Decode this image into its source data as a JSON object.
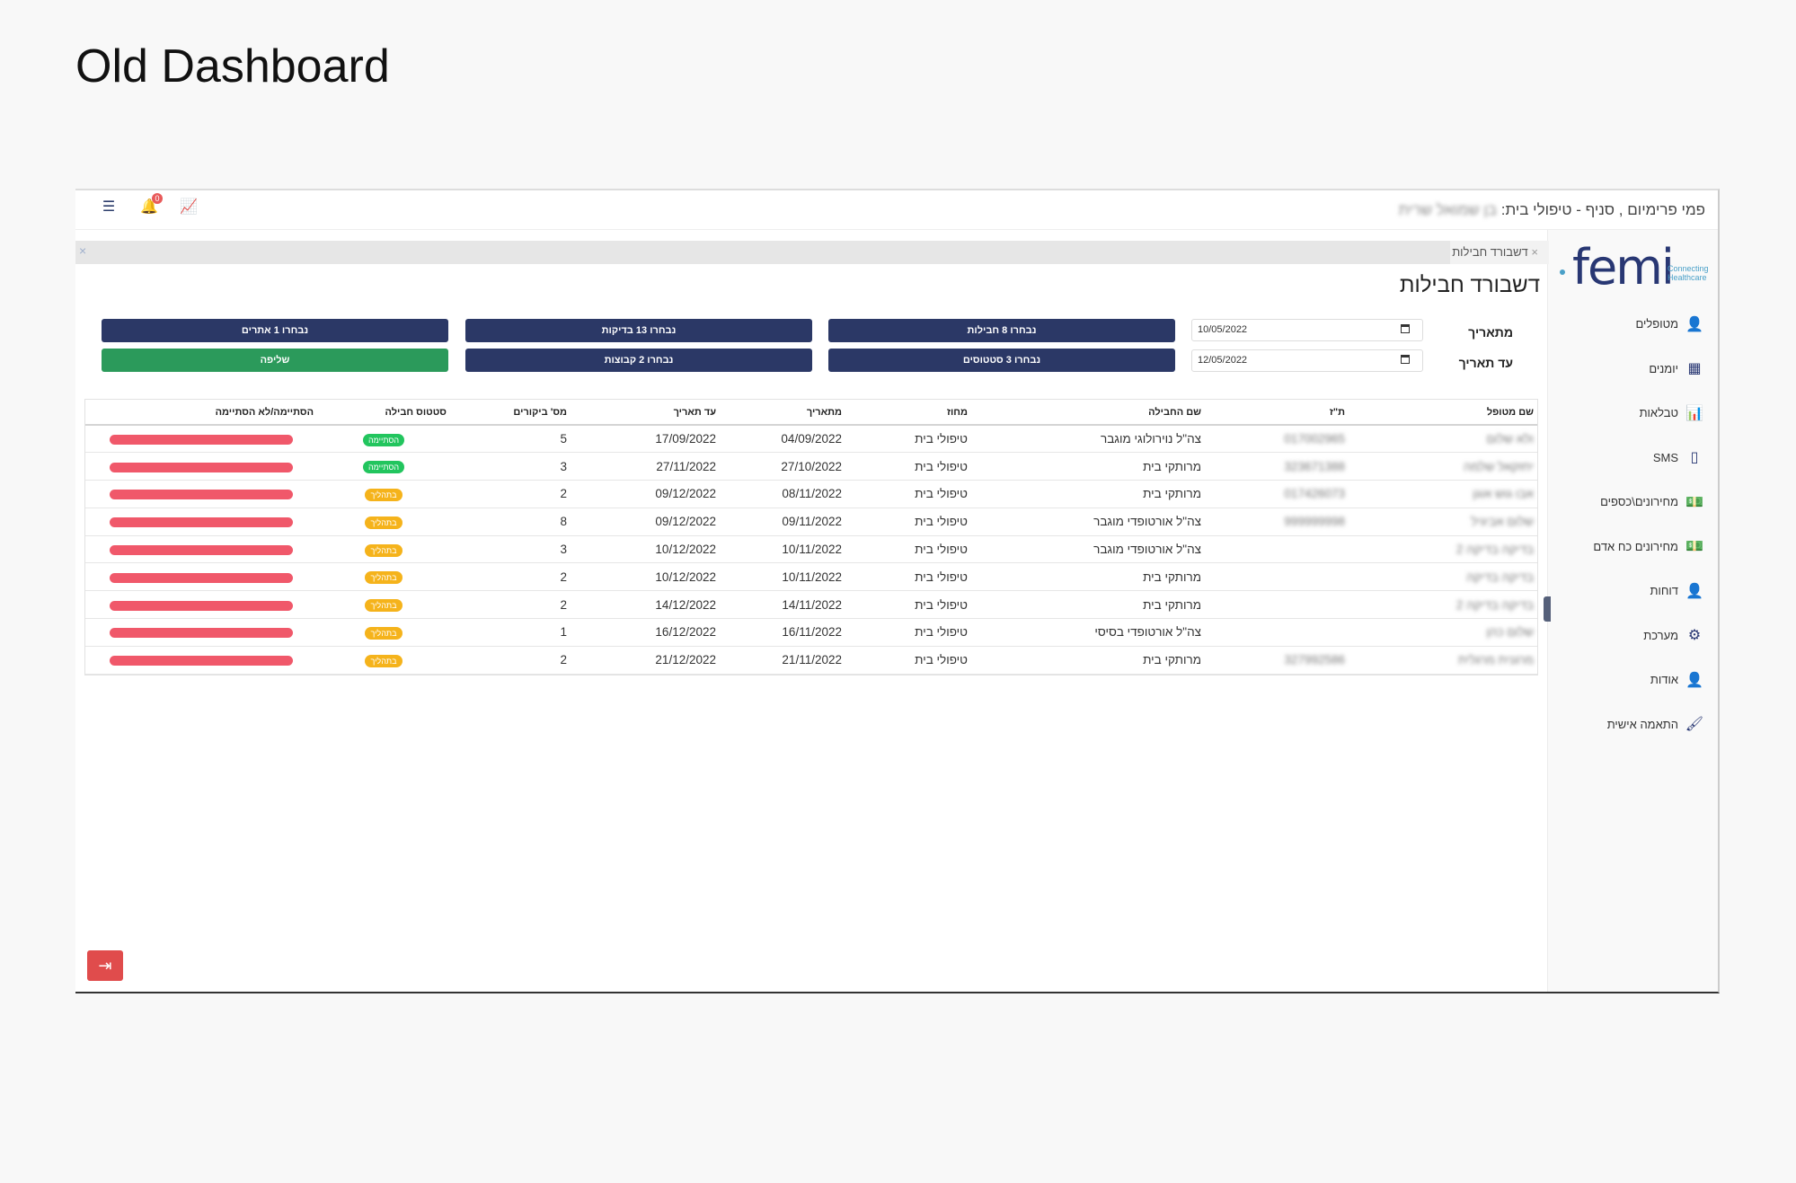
{
  "page_title": "Old Dashboard",
  "topbar": {
    "title_prefix": "פמי פרימיום , סניף - טיפולי בית:",
    "title_user": "בן שמואל שרית",
    "notification_count": "0"
  },
  "logo": {
    "text": "femi",
    "sub": "Connecting Healthcare"
  },
  "sidebar": {
    "items": [
      {
        "label": "מטופלים",
        "icon": "user-icon"
      },
      {
        "label": "יומנים",
        "icon": "calendar-icon"
      },
      {
        "label": "טבלאות",
        "icon": "chart-bar-icon"
      },
      {
        "label": "SMS",
        "icon": "mobile-icon"
      },
      {
        "label": "מחירונים\\כספים",
        "icon": "money-icon"
      },
      {
        "label": "מחירונים כח אדם",
        "icon": "money-icon"
      },
      {
        "label": "דוחות",
        "icon": "user-icon"
      },
      {
        "label": "מערכת",
        "icon": "gears-icon"
      },
      {
        "label": "אודות",
        "icon": "user-icon"
      },
      {
        "label": "התאמה אישית",
        "icon": "brush-icon"
      }
    ]
  },
  "tab": {
    "label": "דשבורד חבילות",
    "close": "×"
  },
  "tabstrip_close": "×",
  "dashboard_title": "דשבורד חבילות",
  "filters": {
    "from_label": "מתאריך",
    "to_label": "עד תאריך",
    "from_value": "10/05/2022",
    "to_value": "12/05/2022",
    "buttons": {
      "packages": "נבחרו 8 חבילות",
      "tests": "נבחרו 13 בדיקות",
      "sites": "נבחרו 1 אתרים",
      "statuses": "נבחרו 3 סטטוסים",
      "groups": "נבחרו 2 קבוצות",
      "fetch": "שליפה"
    }
  },
  "table": {
    "headers": [
      "שם מטופל",
      "ת\"ז",
      "שם החבילה",
      "מחוז",
      "מתאריך",
      "עד תאריך",
      "מס' ביקורים",
      "סטטוס חבילה",
      "הסתיימה/לא הסתיימה"
    ],
    "rows": [
      {
        "name": "ולא שלום",
        "id": "017002965",
        "package": "צה\"ל נוירולוגי מוגבר",
        "district": "טיפולי בית",
        "from": "04/09/2022",
        "to": "17/09/2022",
        "visits": "5",
        "status": "הסתיימה",
        "status_type": "done"
      },
      {
        "name": "יחזקאל שלמה",
        "id": "323671388",
        "package": "מרותקי בית",
        "district": "טיפולי בית",
        "from": "27/10/2022",
        "to": "27/11/2022",
        "visits": "3",
        "status": "הסתיימה",
        "status_type": "done"
      },
      {
        "name": "אבו גוש אוגן",
        "id": "017426073",
        "package": "מרותקי בית",
        "district": "טיפולי בית",
        "from": "08/11/2022",
        "to": "09/12/2022",
        "visits": "2",
        "status": "בתהליך",
        "status_type": "progress"
      },
      {
        "name": "שלום אביגיל",
        "id": "999999998",
        "package": "צה\"ל אורטופדי מוגבר",
        "district": "טיפולי בית",
        "from": "09/11/2022",
        "to": "09/12/2022",
        "visits": "8",
        "status": "בתהליך",
        "status_type": "progress"
      },
      {
        "name": "בדיקה בדיקה 2",
        "id": "",
        "package": "צה\"ל אורטופדי מוגבר",
        "district": "טיפולי בית",
        "from": "10/11/2022",
        "to": "10/12/2022",
        "visits": "3",
        "status": "בתהליך",
        "status_type": "progress"
      },
      {
        "name": "בדיקה בדיקה",
        "id": "",
        "package": "מרותקי בית",
        "district": "טיפולי בית",
        "from": "10/11/2022",
        "to": "10/12/2022",
        "visits": "2",
        "status": "בתהליך",
        "status_type": "progress"
      },
      {
        "name": "בדיקה בדיקה 2",
        "id": "",
        "package": "מרותקי בית",
        "district": "טיפולי בית",
        "from": "14/11/2022",
        "to": "14/12/2022",
        "visits": "2",
        "status": "בתהליך",
        "status_type": "progress"
      },
      {
        "name": "שלום כהן",
        "id": "",
        "package": "צה\"ל אורטופדי בסיסי",
        "district": "טיפולי בית",
        "from": "16/11/2022",
        "to": "16/12/2022",
        "visits": "1",
        "status": "בתהליך",
        "status_type": "progress"
      },
      {
        "name": "מרגנית מרגלית",
        "id": "327992586",
        "package": "מרותקי בית",
        "district": "טיפולי בית",
        "from": "21/11/2022",
        "to": "21/12/2022",
        "visits": "2",
        "status": "בתהליך",
        "status_type": "progress"
      }
    ]
  },
  "colors": {
    "navy": "#2b3866",
    "green": "#2b9a5b",
    "bar_red": "#f0586a",
    "status_done": "#22c55e",
    "status_progress": "#f5b31b",
    "exit_red": "#e04c4c"
  }
}
